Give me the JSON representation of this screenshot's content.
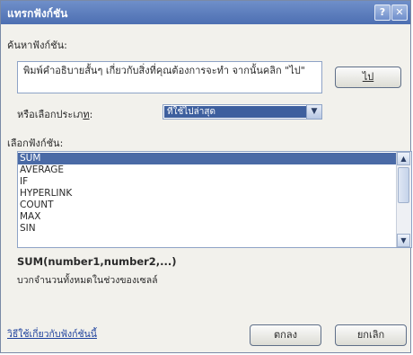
{
  "window": {
    "title": "แทรกฟังก์ชัน",
    "help_glyph": "?",
    "close_glyph": "✕"
  },
  "search": {
    "label": "ค้นหาฟังก์ชัน:",
    "text": "พิมพ์คำอธิบายสั้นๆ เกี่ยวกับสิ่งที่คุณต้องการจะทำ จากนั้นคลิก \"ไป\"",
    "go_label": "ไป"
  },
  "category": {
    "label_prefix": "หรือเลือกประเภ",
    "label_hotkey": "ท",
    "label_suffix": ":",
    "value": "ที่ใช้ไปล่าสุด"
  },
  "functions": {
    "label": "เลือกฟังก์ชัน:",
    "items": [
      "SUM",
      "AVERAGE",
      "IF",
      "HYPERLINK",
      "COUNT",
      "MAX",
      "SIN"
    ],
    "selected_index": 0
  },
  "details": {
    "signature": "SUM(number1,number2,...)",
    "description": "บวกจำนวนทั้งหมดในช่วงของเซลล์"
  },
  "footer": {
    "help_link": "วิธีใช้เกี่ยวกับฟังก์ชันนี้",
    "ok_label": "ตกลง",
    "cancel_label": "ยกเลิก"
  }
}
